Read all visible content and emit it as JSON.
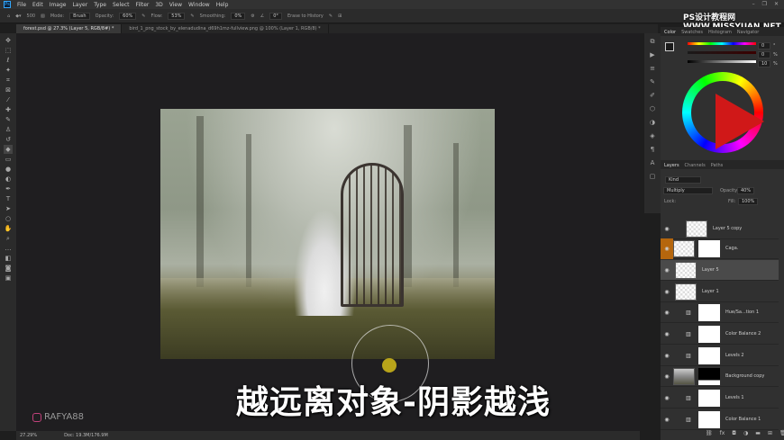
{
  "menu": [
    "File",
    "Edit",
    "Image",
    "Layer",
    "Type",
    "Select",
    "Filter",
    "3D",
    "View",
    "Window",
    "Help"
  ],
  "options": {
    "brush_size": "500",
    "mode_label": "Mode:",
    "mode": "Brush",
    "opacity_label": "Opacity:",
    "opacity": "60%",
    "flow_label": "Flow:",
    "flow": "53%",
    "smoothing_label": "Smoothing:",
    "smoothing": "0%",
    "angle": "0°",
    "erase_history": "Erase to History"
  },
  "tabs": [
    "forest.psd @ 27.3% (Layer 5, RGB/8#) *",
    "bird_1_png_stock_by_elenadudina_d69h1mz-fullview.png @ 100% (Layer 1, RGB/8) *"
  ],
  "watermark": "PS设计教程网  WWW.MISSYUAN.NET",
  "color_panel": {
    "tabs": [
      "Color",
      "Swatches",
      "Histogram",
      "Navigator"
    ],
    "h": "0",
    "s": "0",
    "b": "10",
    "h_unit": "°",
    "s_unit": "%",
    "b_unit": "%"
  },
  "layers_panel": {
    "tabs": [
      "Layers",
      "Channels",
      "Paths"
    ],
    "kind": "Kind",
    "blend": "Multiply",
    "opacity_label": "Opacity:",
    "opacity": "40%",
    "lock_label": "Lock:",
    "fill_label": "Fill:",
    "fill": "100%",
    "layers": [
      {
        "name": "Layer 5 copy",
        "type": "pixel"
      },
      {
        "name": "Caga.",
        "type": "masked",
        "highlight": true
      },
      {
        "name": "Layer 5",
        "type": "pixel",
        "selected": true
      },
      {
        "name": "Layer 1",
        "type": "pixel"
      },
      {
        "name": "Hue/Sa...tion 1",
        "type": "adjustment"
      },
      {
        "name": "Color Balance 2",
        "type": "adjustment"
      },
      {
        "name": "Levels 2",
        "type": "adjustment"
      },
      {
        "name": "Background copy",
        "type": "masked-dark"
      },
      {
        "name": "Levels 1",
        "type": "adjustment"
      },
      {
        "name": "Color Balance 1",
        "type": "adjustment"
      }
    ]
  },
  "status": {
    "zoom": "27.29%",
    "doc": "Doc: 19.3M/176.9M"
  },
  "subtitle": "越远离对象-阴影越浅",
  "instagram": "RAFYA88"
}
